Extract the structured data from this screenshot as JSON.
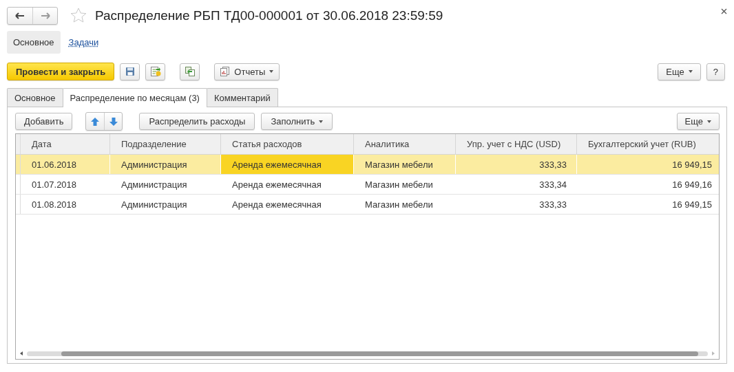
{
  "window": {
    "title": "Распределение РБП ТД00-000001 от 30.06.2018 23:59:59",
    "favorite": false
  },
  "nav": [
    {
      "label": "Основное",
      "selected": true
    },
    {
      "label": "Задачи",
      "selected": false
    }
  ],
  "toolbar": {
    "primary": "Провести и закрыть",
    "icon_buttons": [
      {
        "kind": "save"
      },
      {
        "kind": "post"
      },
      {
        "kind": "copy"
      }
    ],
    "reports": "Отчеты",
    "more": "Еще",
    "help": "?"
  },
  "tabs": [
    {
      "label": "Основное",
      "selected": false
    },
    {
      "label": "Распределение по месяцам (3)",
      "selected": true
    },
    {
      "label": "Комментарий",
      "selected": false
    }
  ],
  "table_toolbar": {
    "add": "Добавить",
    "distribute": "Распределить расходы",
    "fill": "Заполнить",
    "more": "Еще"
  },
  "table": {
    "columns": [
      {
        "label": "Дата",
        "kind": "text"
      },
      {
        "label": "Подразделение",
        "kind": "text"
      },
      {
        "label": "Статья расходов",
        "kind": "text"
      },
      {
        "label": "Аналитика",
        "kind": "text"
      },
      {
        "label": "Упр. учет с НДС (USD)",
        "kind": "number"
      },
      {
        "label": "Бухгалтерский учет (RUB)",
        "kind": "number"
      }
    ],
    "rows": [
      {
        "selected": true,
        "cells": [
          {
            "text": "01.06.2018",
            "current": false
          },
          {
            "text": "Администрация",
            "current": false
          },
          {
            "text": "Аренда ежемесячная",
            "current": true
          },
          {
            "text": "Магазин мебели",
            "current": false
          },
          {
            "text": "333,33",
            "current": false
          },
          {
            "text": "16 949,15",
            "current": false
          }
        ]
      },
      {
        "selected": false,
        "cells": [
          {
            "text": "01.07.2018",
            "current": false
          },
          {
            "text": "Администрация",
            "current": false
          },
          {
            "text": "Аренда ежемесячная",
            "current": false
          },
          {
            "text": "Магазин мебели",
            "current": false
          },
          {
            "text": "333,34",
            "current": false
          },
          {
            "text": "16 949,16",
            "current": false
          }
        ]
      },
      {
        "selected": false,
        "cells": [
          {
            "text": "01.08.2018",
            "current": false
          },
          {
            "text": "Администрация",
            "current": false
          },
          {
            "text": "Аренда ежемесячная",
            "current": false
          },
          {
            "text": "Магазин мебели",
            "current": false
          },
          {
            "text": "333,33",
            "current": false
          },
          {
            "text": "16 949,15",
            "current": false
          }
        ]
      }
    ]
  }
}
